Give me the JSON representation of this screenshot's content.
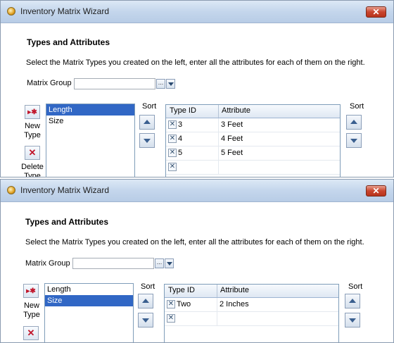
{
  "panels": [
    {
      "title": "Inventory Matrix Wizard",
      "close": "✕",
      "heading": "Types and Attributes",
      "instructions": "Select the Matrix Types you created on the left, enter all the attributes for each of them on the right.",
      "matrix_group_label": "Matrix Group",
      "matrix_group_value": "",
      "new_type_label": "New Type",
      "delete_type_label": "Delete Type",
      "types": [
        "Length",
        "Size"
      ],
      "selected_type": "Length",
      "sort_label": "Sort",
      "grid_headers": [
        "Type ID",
        "Attribute"
      ],
      "rows": [
        {
          "id": "3",
          "attr": "3 Feet"
        },
        {
          "id": "4",
          "attr": "4 Feet"
        },
        {
          "id": "5",
          "attr": "5 Feet"
        }
      ]
    },
    {
      "title": "Inventory Matrix Wizard",
      "close": "✕",
      "heading": "Types and Attributes",
      "instructions": "Select the Matrix Types you created on the left, enter all the attributes for each of them on the right.",
      "matrix_group_label": "Matrix Group",
      "matrix_group_value": "",
      "new_type_label": "New Type",
      "types": [
        "Length",
        "Size"
      ],
      "selected_type": "Size",
      "sort_label": "Sort",
      "grid_headers": [
        "Type ID",
        "Attribute"
      ],
      "rows": [
        {
          "id": "Two",
          "attr": "2 Inches"
        }
      ]
    }
  ],
  "icons": {
    "app": "wizard-app-icon",
    "new_type": "new-type-icon",
    "delete_type": "delete-type-icon",
    "row_delete": "delete-row-icon",
    "sort_up": "arrow-up-icon",
    "sort_down": "arrow-down-icon"
  },
  "colors": {
    "selection": "#3167c5",
    "close_button": "#c9452d",
    "titlebar": "#c4d6ec"
  }
}
